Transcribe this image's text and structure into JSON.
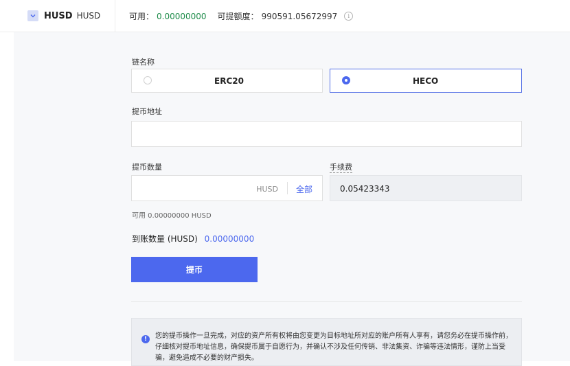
{
  "header": {
    "coin_name": "HUSD",
    "coin_sub": "HUSD",
    "available_label": "可用：",
    "available_value": "0.00000000",
    "limit_label": "可提额度：",
    "limit_value": "990591.05672997",
    "info_glyph": "i"
  },
  "form": {
    "chain_label": "链名称",
    "chains": [
      {
        "name": "ERC20",
        "selected": false
      },
      {
        "name": "HECO",
        "selected": true
      }
    ],
    "address_label": "提币地址",
    "address_value": "",
    "address_placeholder": "",
    "amount_label": "提币数量",
    "amount_value": "",
    "amount_unit": "HUSD",
    "all_button": "全部",
    "fee_label": "手续费",
    "fee_value": "0.05423343",
    "available_text": "可用 0.00000000 HUSD",
    "arrive_label": "到账数量 (HUSD)",
    "arrive_value": "0.00000000",
    "submit_label": "提币"
  },
  "notice": {
    "text": "您的提币操作一旦完成，对应的资产所有权将由您变更为目标地址所对应的账户所有人享有，请您务必在提币操作前，仔细核对提币地址信息，确保提币属于自愿行为，并确认不涉及任何传销、非法集资、诈骗等违法情形，谨防上当受骗，避免造成不必要的财产损失。"
  },
  "colors": {
    "accent": "#4c68ee",
    "available_green": "#1e8c4a"
  }
}
